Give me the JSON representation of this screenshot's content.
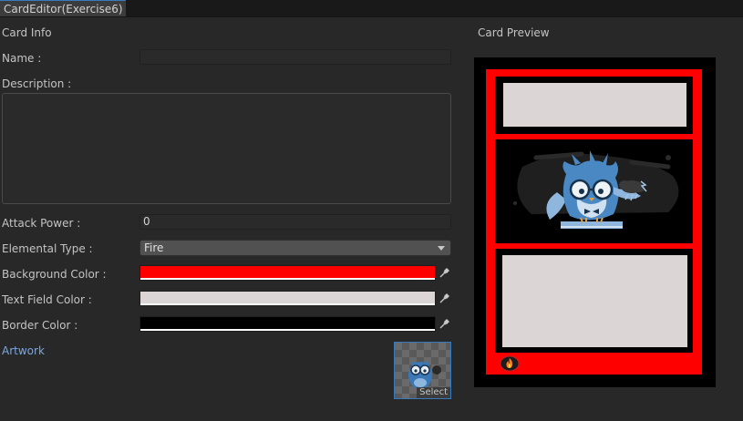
{
  "window": {
    "tab_title": "CardEditor(Exercise6)"
  },
  "card_info": {
    "section_title": "Card Info",
    "name_label": "Name :",
    "name_value": "",
    "description_label": "Description :",
    "description_value": "",
    "attack_label": "Attack Power :",
    "attack_value": "0",
    "elemental_label": "Elemental Type :",
    "elemental_value": "Fire",
    "bg_color_label": "Background Color :",
    "text_field_color_label": "Text Field Color :",
    "border_color_label": "Border Color :",
    "artwork_label": "Artwork",
    "artwork_select": "Select"
  },
  "colors": {
    "background": "#ff0000",
    "text_field": "#dcd5d5",
    "border": "#000000"
  },
  "preview": {
    "section_title": "Card Preview"
  },
  "icons": {
    "picker": "eyedropper-icon",
    "fire": "fire-icon",
    "dropdown_arrow": "chevron-down-icon",
    "artwork": "owl-mascot-icon"
  }
}
